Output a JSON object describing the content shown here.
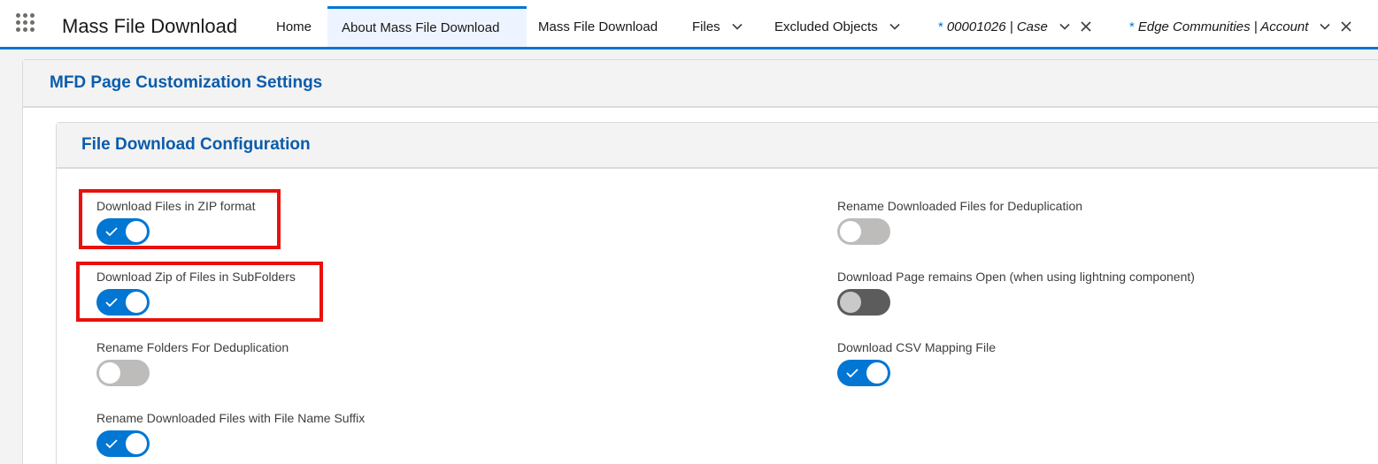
{
  "app": {
    "name": "Mass File Download"
  },
  "nav": {
    "home": "Home",
    "about": "About Mass File Download",
    "mfd": "Mass File Download",
    "files": "Files",
    "excluded": "Excluded Objects",
    "tab_case": {
      "dirty": "*",
      "label": "00001026 | Case"
    },
    "tab_account": {
      "dirty": "*",
      "label": "Edge Communities | Account"
    }
  },
  "outer": {
    "title": "MFD Page Customization Settings"
  },
  "inner": {
    "title": "File Download Configuration"
  },
  "settings": {
    "zip_format": {
      "label": "Download Files in ZIP format",
      "state": "on"
    },
    "zip_subfolders": {
      "label": "Download Zip of Files in SubFolders",
      "state": "on"
    },
    "rename_folders": {
      "label": "Rename Folders For Deduplication",
      "state": "off"
    },
    "rename_suffix": {
      "label": "Rename Downloaded Files with File Name Suffix",
      "state": "on"
    },
    "rename_dedup": {
      "label": "Rename Downloaded Files for Deduplication",
      "state": "off"
    },
    "page_open": {
      "label": "Download Page remains Open (when using lightning component)",
      "state": "off"
    },
    "csv_mapping": {
      "label": "Download CSV Mapping File",
      "state": "on"
    }
  },
  "colors": {
    "brand": "#0176d3",
    "title": "#0b5cab",
    "highlight": "#e8110f"
  }
}
